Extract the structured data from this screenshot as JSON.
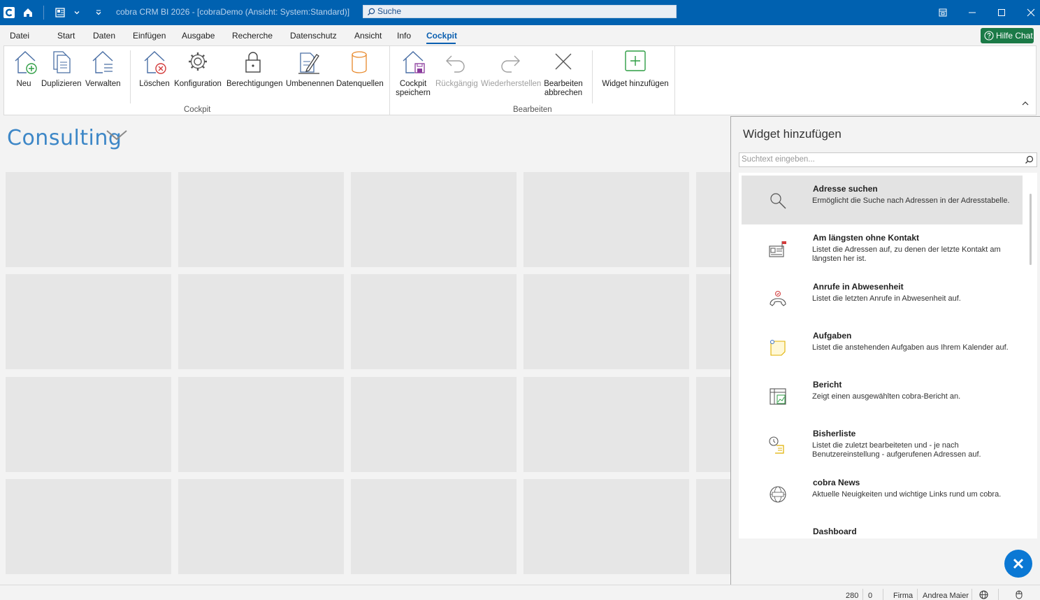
{
  "titlebar": {
    "title": "cobra CRM BI 2026 - [cobraDemo (Ansicht: System:Standard)]",
    "search_placeholder": "Suche",
    "icons": [
      "cobra-logo-icon",
      "home-icon",
      "address-card-icon",
      "dropdown-icon",
      "quick-access-icon",
      "restore-icon",
      "minimize-icon",
      "maximize-icon",
      "close-icon"
    ]
  },
  "menu": {
    "items": [
      "Datei",
      "Start",
      "Daten",
      "Einfügen",
      "Ausgabe",
      "Recherche",
      "Datenschutz",
      "Ansicht",
      "Info",
      "Cockpit"
    ],
    "active": "Cockpit",
    "help_chat": "Hilfe Chat"
  },
  "ribbon": {
    "group_cockpit": "Cockpit",
    "group_bearbeiten": "Bearbeiten",
    "buttons": {
      "neu": "Neu",
      "duplizieren": "Duplizieren",
      "verwalten": "Verwalten",
      "loeschen": "Löschen",
      "konfiguration": "Konfiguration",
      "berechtigungen": "Berechtigungen",
      "umbenennen": "Umbenennen",
      "datenquellen": "Datenquellen",
      "cockpit_speichern_1": "Cockpit",
      "cockpit_speichern_2": "speichern",
      "rueckgaengig": "Rückgängig",
      "wiederherstellen": "Wiederherstellen",
      "bearbeiten_abbrechen_1": "Bearbeiten",
      "bearbeiten_abbrechen_2": "abbrechen",
      "widget_hinzufuegen": "Widget hinzufügen"
    }
  },
  "cockpit": {
    "name": "Consulting"
  },
  "panel": {
    "title": "Widget hinzufügen",
    "search_placeholder": "Suchtext eingeben...",
    "widgets": [
      {
        "name": "Adresse suchen",
        "desc": "Ermöglicht die Suche nach Adressen in der Adresstabelle.",
        "icon": "magnifier-icon",
        "selected": true
      },
      {
        "name": "Am längsten ohne Kontakt",
        "desc": "Listet die Adressen auf, zu denen der letzte Kontakt am längsten her ist.",
        "icon": "contact-card-flag-icon"
      },
      {
        "name": "Anrufe in Abwesenheit",
        "desc": "Listet die letzten Anrufe in Abwesenheit auf.",
        "icon": "missed-call-icon"
      },
      {
        "name": "Aufgaben",
        "desc": "Listet die anstehenden Aufgaben aus Ihrem Kalender auf.",
        "icon": "task-note-icon"
      },
      {
        "name": "Bericht",
        "desc": "Zeigt einen ausgewählten cobra-Bericht an.",
        "icon": "report-icon"
      },
      {
        "name": "Bisherliste",
        "desc": "Listet die zuletzt bearbeiteten und - je nach Benutzereinstellung - aufgerufenen Adressen auf.",
        "icon": "history-list-icon"
      },
      {
        "name": "cobra News",
        "desc": "Aktuelle Neuigkeiten und wichtige Links rund um cobra.",
        "icon": "news-globe-icon"
      },
      {
        "name": "Dashboard",
        "desc": "",
        "icon": "dashboard-icon"
      }
    ]
  },
  "status": {
    "count": "280",
    "selected": "0",
    "table": "Firma",
    "user": "Andrea Maier"
  }
}
